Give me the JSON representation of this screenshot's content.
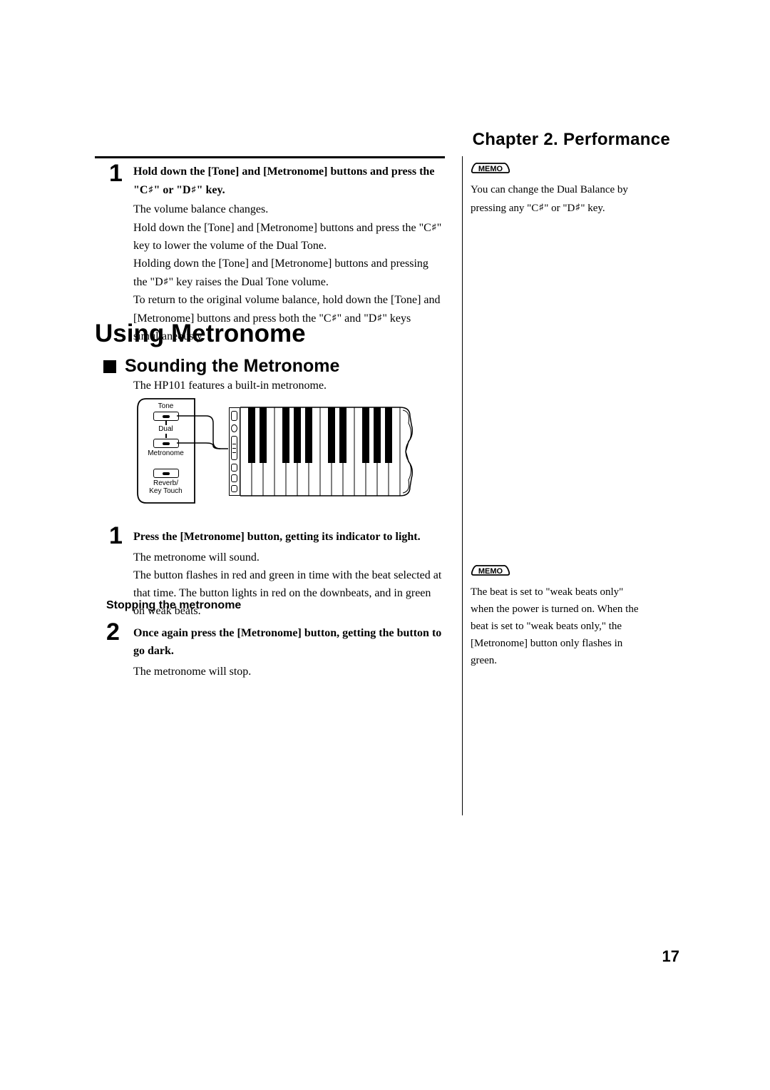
{
  "chapter": "Chapter 2. Performance",
  "step1": {
    "bold_a": "Hold down the [Tone] and [Metronome] buttons and press the \"C",
    "bold_b": "\" or \"D",
    "bold_c": "\" key.",
    "p1": "The volume balance changes.",
    "p2a": "Hold down the [Tone] and [Metronome] buttons and press the \"C",
    "p2b": "\" key to lower the volume of the Dual Tone.",
    "p3a": "Holding down the [Tone] and [Metronome] buttons and pressing the \"D",
    "p3b": "\" key raises the Dual Tone volume.",
    "p4a": "To return to the original volume balance, hold down the [Tone] and [Metronome] buttons and press both the \"C",
    "p4b": "\" and \"D",
    "p4c": "\" keys simultaneously."
  },
  "h1": "Using Metronome",
  "h2": "Sounding the Metronome",
  "intro": "The HP101 features a built-in metronome.",
  "panel": {
    "tone": "Tone",
    "dual": "Dual",
    "metronome": "Metronome",
    "reverb": "Reverb/\nKey Touch"
  },
  "step_metronome_1": {
    "bold": "Press the [Metronome] button, getting its indicator to light.",
    "p1": "The metronome will sound.",
    "p2": "The button flashes in red and green in time with the beat selected at that time. The button lights in red on the downbeats, and in green on weak beats."
  },
  "subhead": "Stopping the metronome",
  "step_metronome_2": {
    "bold": "Once again press the [Metronome] button, getting the button to go dark.",
    "p1": "The metronome will stop."
  },
  "memo_label": "MEMO",
  "memo1_a": "You can change the Dual Balance by pressing any \"C",
  "memo1_b": "\" or \"D",
  "memo1_c": "\" key.",
  "memo2": "The beat is set to \"weak beats only\" when the power is turned on. When the beat is set to \"weak beats only,\" the [Metronome] button only flashes in green.",
  "page_number": "17",
  "sharp": "♯",
  "nums": {
    "one": "1",
    "two": "2"
  }
}
